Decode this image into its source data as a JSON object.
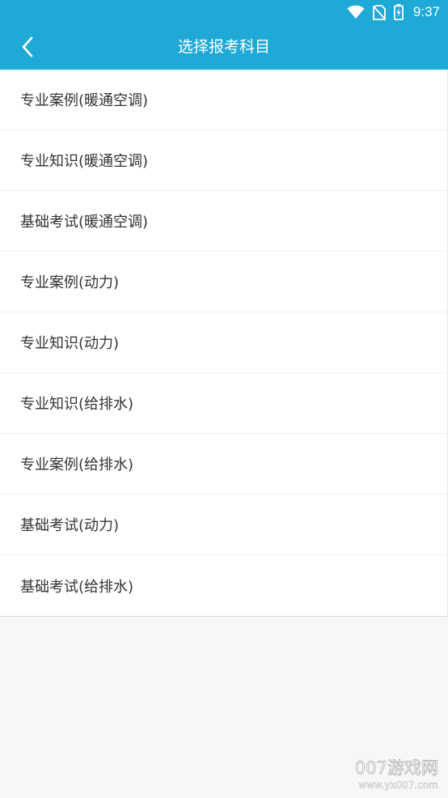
{
  "colors": {
    "primary": "#1fa9d6",
    "background": "#f7f7f7",
    "text": "#333333"
  },
  "status_bar": {
    "time": "9:37",
    "icons": [
      "wifi-icon",
      "no-sim-icon",
      "battery-charging-icon"
    ]
  },
  "toolbar": {
    "back_icon": "chevron-left-icon",
    "title": "选择报考科目"
  },
  "subjects": [
    {
      "label": "专业案例(暖通空调)"
    },
    {
      "label": "专业知识(暖通空调)"
    },
    {
      "label": "基础考试(暖通空调)"
    },
    {
      "label": "专业案例(动力)"
    },
    {
      "label": "专业知识(动力)"
    },
    {
      "label": "专业知识(给排水)"
    },
    {
      "label": "专业案例(给排水)"
    },
    {
      "label": "基础考试(动力)"
    },
    {
      "label": "基础考试(给排水)"
    }
  ],
  "watermark": {
    "line1": "007游戏网",
    "line2": "www.yx007.com"
  }
}
